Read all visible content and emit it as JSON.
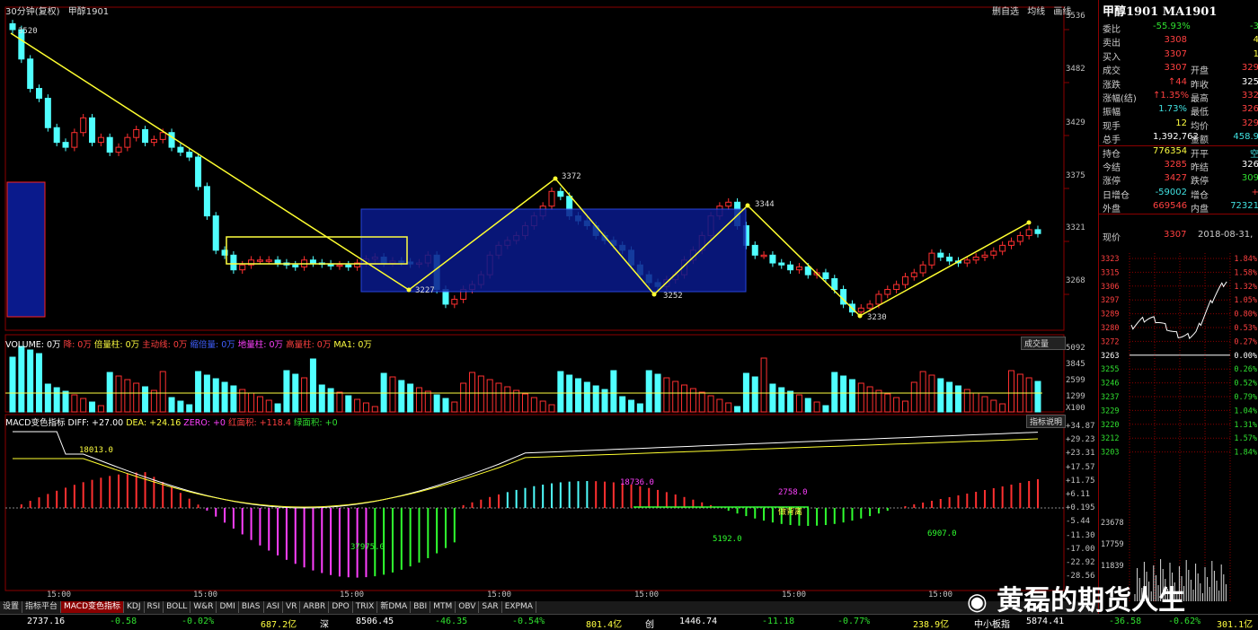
{
  "header": {
    "title": "30分钟(复权)",
    "instrument": "甲醇1901"
  },
  "top_buttons": [
    "删自选",
    "均线",
    "画线"
  ],
  "price_axis": [
    "3536",
    "3482",
    "3429",
    "3375",
    "3321",
    "3268"
  ],
  "annotations": {
    "p1": "3520",
    "p2": "3227",
    "p3": "3372",
    "p4": "3252",
    "p5": "3344",
    "p6": "3230"
  },
  "volume_header": {
    "label": "VOLUME: 0万",
    "items": [
      "降: 0万",
      "倍量柱: 0万",
      "主动线: 0万",
      "缩倍量: 0万",
      "地量柱: 0万",
      "高量柱: 0万",
      "MA1: 0万"
    ]
  },
  "volume_axis": [
    "5092",
    "3845",
    "2599",
    "1299",
    "X100"
  ],
  "volume_button": "成交量",
  "macd_header": {
    "label": "MACD变色指标",
    "diff": "DIFF: +27.00",
    "dea": "DEA: +24.16",
    "zero": "ZERO: +0",
    "red": "红面积: +118.4",
    "green": "绿面积: +0"
  },
  "macd_button": "指标说明",
  "macd_axis": [
    "+34.87",
    "+29.23",
    "+23.31",
    "+17.57",
    "+11.75",
    "+6.11",
    "+0.195",
    "-5.44",
    "-11.30",
    "-17.00",
    "-22.92",
    "-28.56"
  ],
  "macd_notes": [
    "18013.0",
    "18736.0",
    "2758.0",
    "37975.0",
    "5192.0",
    "6907.0",
    "做背离"
  ],
  "time_axis": [
    "15:00",
    "15:00",
    "15:00",
    "15:00",
    "15:00",
    "15:00",
    "15:00"
  ],
  "tabs": [
    "设置",
    "指标平台",
    "MACD变色指标",
    "KDJ",
    "RSI",
    "BOLL",
    "W&R",
    "DMI",
    "BIAS",
    "ASI",
    "VR",
    "ARBR",
    "DPO",
    "TRIX",
    "新DMA",
    "BBI",
    "MTM",
    "OBV",
    "SAR",
    "EXPMA"
  ],
  "quote": {
    "title": "甲醇1901 MA1901",
    "rows": [
      {
        "k": "委比",
        "v": "-55.93%",
        "vc": "green",
        "k2": "",
        "v2": "-3",
        "v2c": "green"
      },
      {
        "k": "卖出",
        "v": "3308",
        "vc": "red",
        "k2": "",
        "v2": "4",
        "v2c": "yel"
      },
      {
        "k": "买入",
        "v": "3307",
        "vc": "red",
        "k2": "",
        "v2": "1",
        "v2c": "yel"
      },
      {
        "k": "成交",
        "v": "3307",
        "vc": "red",
        "k2": "开盘",
        "v2": "329",
        "v2c": "red"
      },
      {
        "k": "涨跌",
        "v": "↑44",
        "vc": "red",
        "k2": "昨收",
        "v2": "325",
        "v2c": "white"
      },
      {
        "k": "涨幅(结)",
        "v": "↑1.35%",
        "vc": "red",
        "k2": "最高",
        "v2": "332",
        "v2c": "red"
      },
      {
        "k": "振幅",
        "v": "1.73%",
        "vc": "cyan",
        "k2": "最低",
        "v2": "326",
        "v2c": "red"
      },
      {
        "k": "现手",
        "v": "12",
        "vc": "yel",
        "k2": "均价",
        "v2": "329",
        "v2c": "red"
      },
      {
        "k": "总手",
        "v": "1,392,762",
        "vc": "white",
        "k2": "金额",
        "v2": "458.9",
        "v2c": "cyan"
      },
      {
        "k": "持仓",
        "v": "776354",
        "vc": "yel",
        "k2": "开平",
        "v2": "空",
        "v2c": "cyan"
      },
      {
        "k": "今结",
        "v": "3285",
        "vc": "red",
        "k2": "昨结",
        "v2": "326",
        "v2c": "white"
      },
      {
        "k": "涨停",
        "v": "3427",
        "vc": "red",
        "k2": "跌停",
        "v2": "309",
        "v2c": "green"
      },
      {
        "k": "日增仓",
        "v": "-59002",
        "vc": "cyan",
        "k2": "增仓",
        "v2": "+",
        "v2c": "red"
      },
      {
        "k": "外盘",
        "v": "669546",
        "vc": "red",
        "k2": "内盘",
        "v2": "72321",
        "v2c": "cyan"
      }
    ],
    "now_label": "现价",
    "now_value": "3307",
    "date": "2018-08-31,"
  },
  "mini_axis_left": [
    "3323",
    "3315",
    "3306",
    "3297",
    "3289",
    "3280",
    "3272",
    "3263",
    "3255",
    "3246",
    "3237",
    "3229",
    "3220",
    "3212",
    "3203"
  ],
  "mini_axis_right": [
    "1.84%",
    "1.58%",
    "1.32%",
    "1.05%",
    "0.80%",
    "0.53%",
    "0.27%",
    "0.00%",
    "0.26%",
    "0.52%",
    "0.79%",
    "1.04%",
    "1.31%",
    "1.57%",
    "1.84%"
  ],
  "mini_vol_axis": [
    "23678",
    "17759",
    "11839"
  ],
  "status": [
    {
      "t": "2737.16",
      "c": "white"
    },
    {
      "t": "-0.58",
      "c": "green"
    },
    {
      "t": "-0.02%",
      "c": "green"
    },
    {
      "t": "687.2亿",
      "c": "yel"
    },
    {
      "t": "深",
      "c": "white"
    },
    {
      "t": "8506.45",
      "c": "white"
    },
    {
      "t": "-46.35",
      "c": "green"
    },
    {
      "t": "-0.54%",
      "c": "green"
    },
    {
      "t": "801.4亿",
      "c": "yel"
    },
    {
      "t": "创",
      "c": "white"
    },
    {
      "t": "1446.74",
      "c": "white"
    },
    {
      "t": "-11.18",
      "c": "green"
    },
    {
      "t": "-0.77%",
      "c": "green"
    },
    {
      "t": "238.9亿",
      "c": "yel"
    },
    {
      "t": "中小板指",
      "c": "white"
    },
    {
      "t": "5874.41",
      "c": "white"
    },
    {
      "t": "-36.58",
      "c": "green"
    },
    {
      "t": "-0.62%",
      "c": "green"
    },
    {
      "t": "301.1亿",
      "c": "yel"
    }
  ],
  "watermark": "黄磊的期货人生"
}
